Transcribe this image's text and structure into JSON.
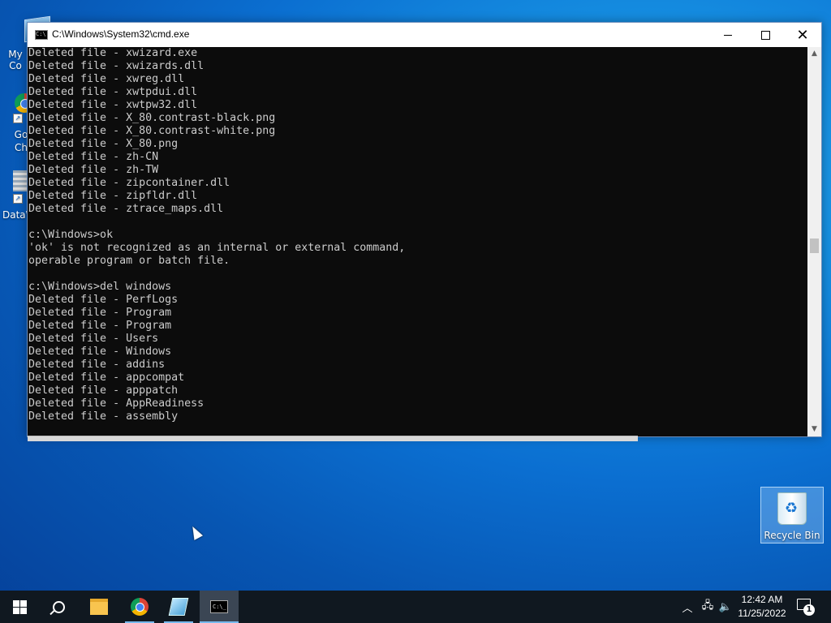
{
  "desktop": {
    "icons": [
      {
        "label": "My Co"
      },
      {
        "label": "Go\nCh"
      },
      {
        "label": "DataW"
      }
    ],
    "recycle_bin": {
      "label": "Recycle Bin"
    }
  },
  "window": {
    "title": "C:\\Windows\\System32\\cmd.exe",
    "console_lines": [
      "Deleted file - xwizard.exe",
      "Deleted file - xwizards.dll",
      "Deleted file - xwreg.dll",
      "Deleted file - xwtpdui.dll",
      "Deleted file - xwtpw32.dll",
      "Deleted file - X_80.contrast-black.png",
      "Deleted file - X_80.contrast-white.png",
      "Deleted file - X_80.png",
      "Deleted file - zh-CN",
      "Deleted file - zh-TW",
      "Deleted file - zipcontainer.dll",
      "Deleted file - zipfldr.dll",
      "Deleted file - ztrace_maps.dll",
      "",
      "c:\\Windows>ok",
      "'ok' is not recognized as an internal or external command,",
      "operable program or batch file.",
      "",
      "c:\\Windows>del windows",
      "Deleted file - PerfLogs",
      "Deleted file - Program",
      "Deleted file - Program",
      "Deleted file - Users",
      "Deleted file - Windows",
      "Deleted file - addins",
      "Deleted file - appcompat",
      "Deleted file - apppatch",
      "Deleted file - AppReadiness",
      "Deleted file - assembly"
    ]
  },
  "taskbar": {
    "clock_time": "12:42 AM",
    "clock_date": "11/25/2022",
    "notification_count": "1"
  },
  "icons": [
    "windows-logo-icon",
    "search-icon",
    "file-explorer-icon",
    "chrome-icon",
    "app-icon",
    "cmd-icon",
    "chevron-up-icon",
    "network-icon",
    "volume-icon",
    "notification-icon",
    "recycle-bin-icon"
  ]
}
